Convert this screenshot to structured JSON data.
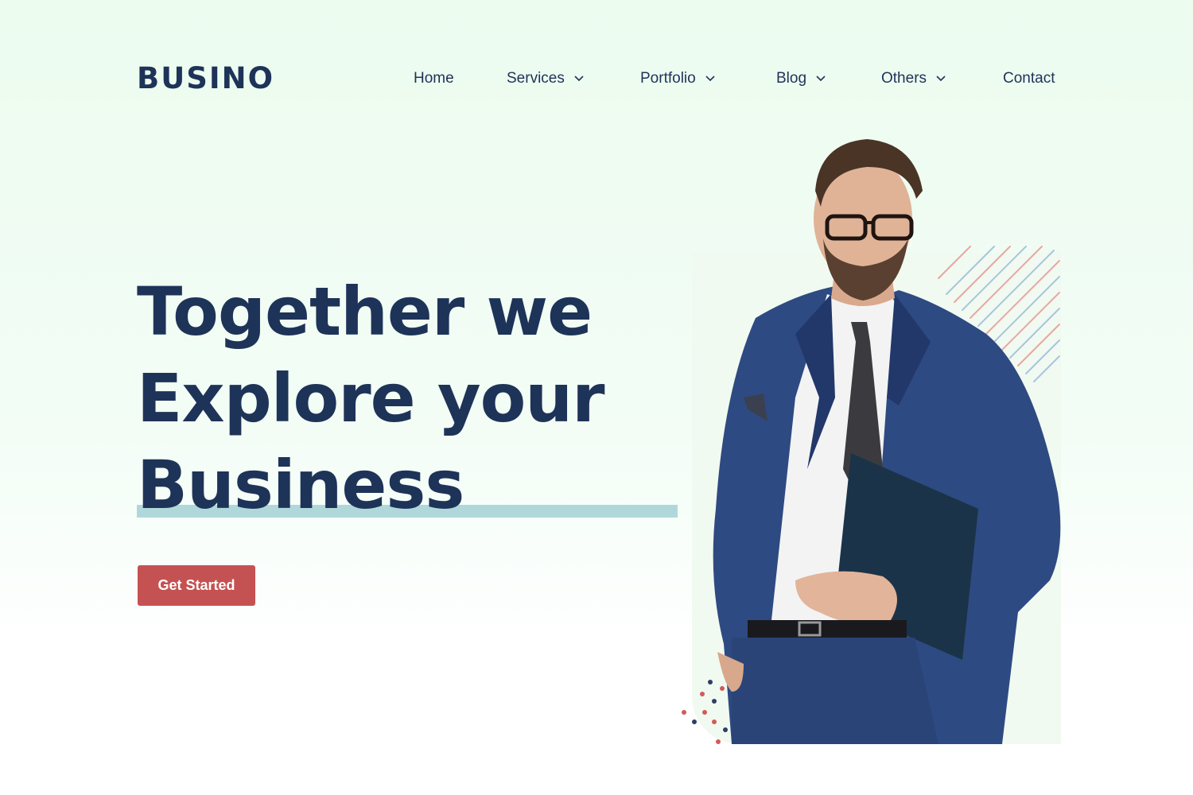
{
  "brand": {
    "name": "BUSINO"
  },
  "nav": {
    "items": [
      {
        "label": "Home",
        "has_dropdown": false,
        "icon": ""
      },
      {
        "label": "Services",
        "has_dropdown": true,
        "icon": "chevron-down-icon"
      },
      {
        "label": "Portfolio",
        "has_dropdown": true,
        "icon": "chevron-down-icon"
      },
      {
        "label": "Blog",
        "has_dropdown": true,
        "icon": "chevron-down-icon"
      },
      {
        "label": "Others",
        "has_dropdown": true,
        "icon": "chevron-down-icon"
      },
      {
        "label": "Contact",
        "has_dropdown": false,
        "icon": ""
      }
    ]
  },
  "hero": {
    "line1": "Together we",
    "line2": "Explore your",
    "line3": "Business",
    "cta_label": "Get Started"
  },
  "colors": {
    "text_primary": "#1e3358",
    "accent_red": "#c55252",
    "highlight": "#b0d8da",
    "background": "#ecfcef",
    "suit_blue": "#2e4a82"
  }
}
